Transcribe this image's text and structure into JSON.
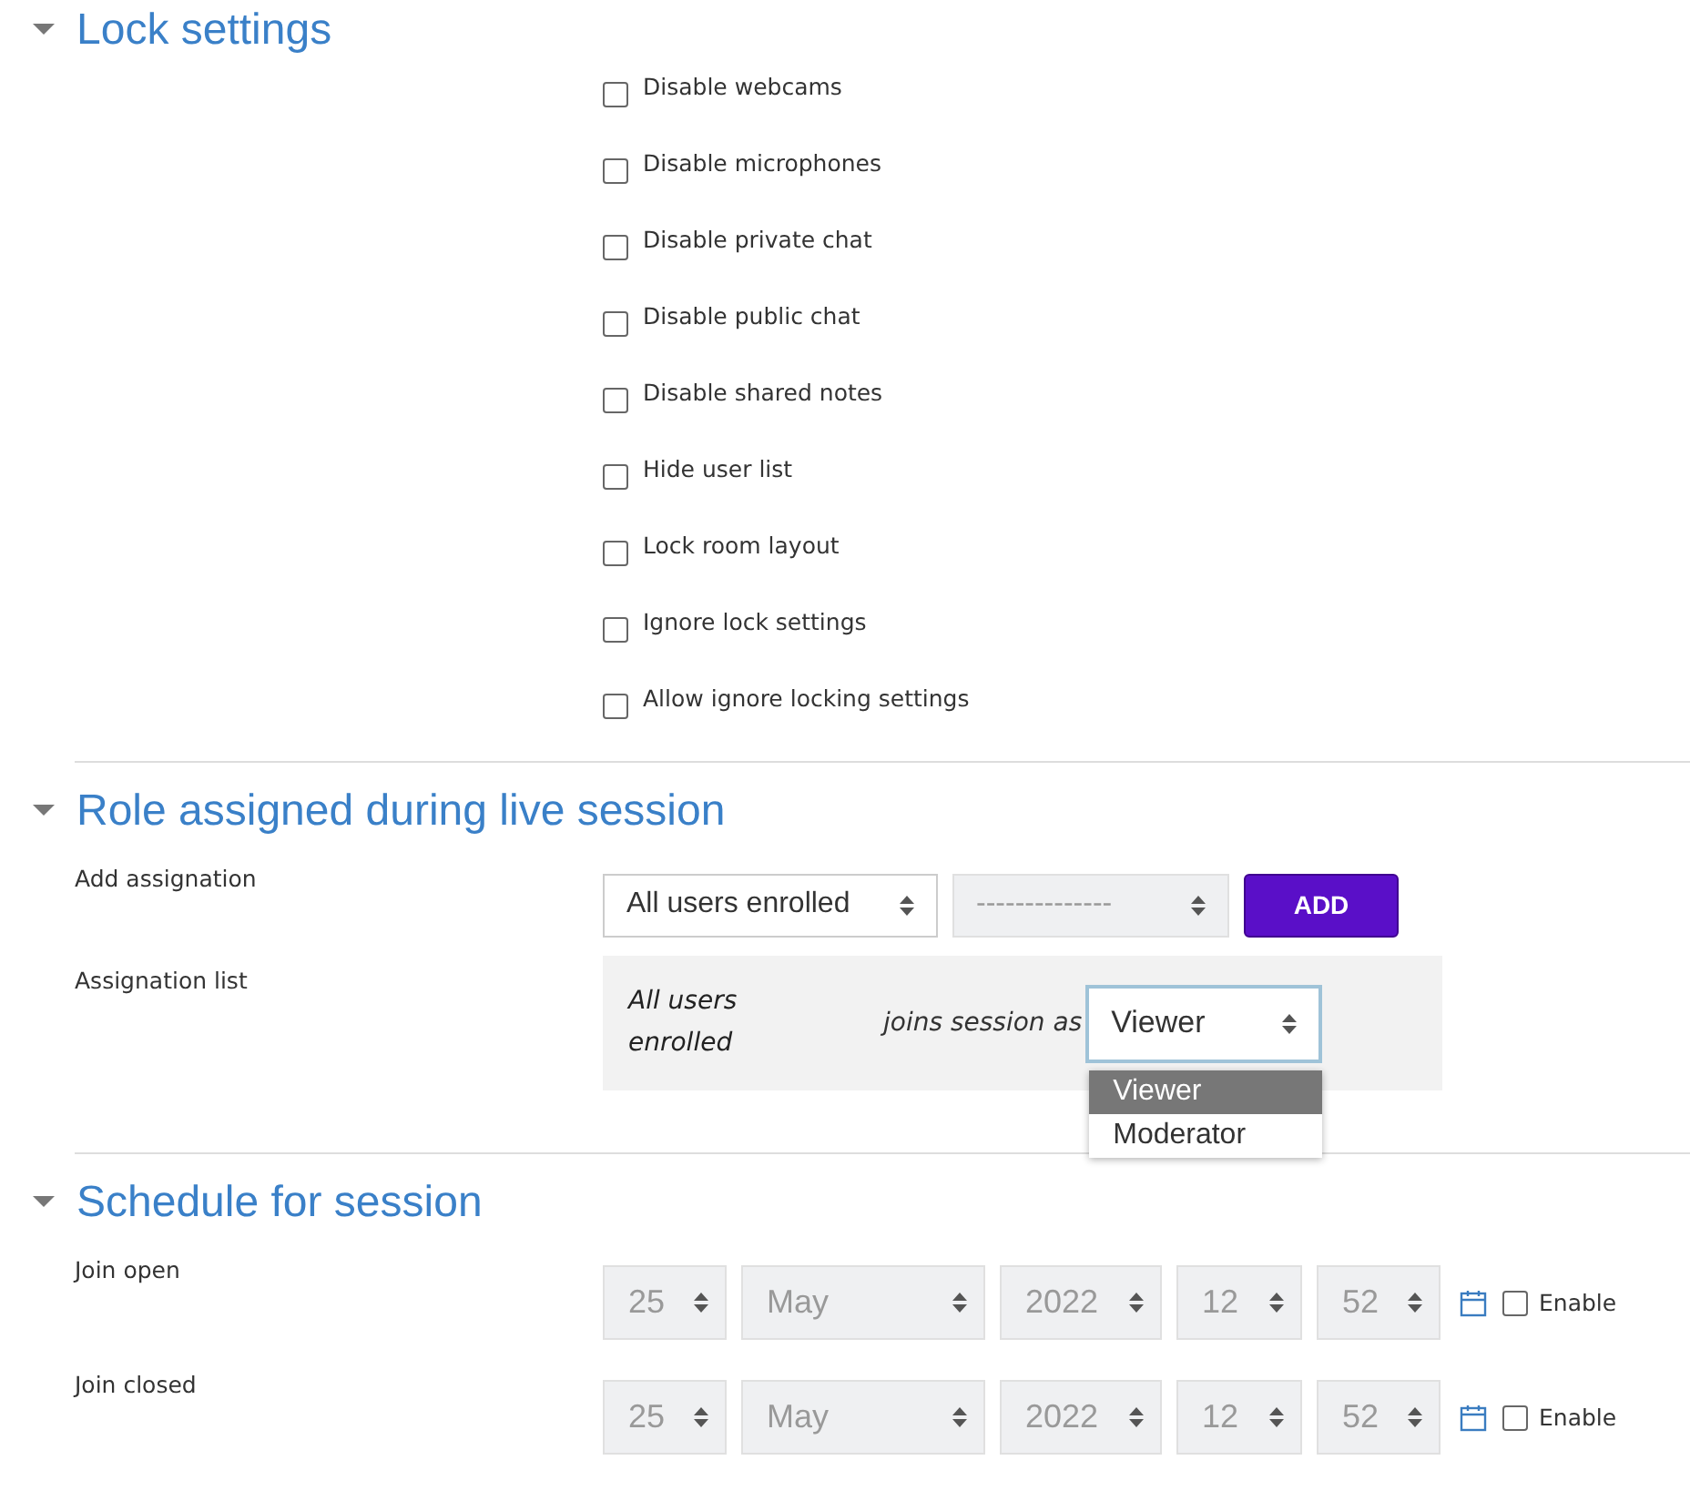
{
  "sections": [
    {
      "kind": "checkboxes",
      "title": "Lock settings",
      "expanded": true,
      "options": [
        {
          "label": "Disable webcams",
          "checked": false
        },
        {
          "label": "Disable microphones",
          "checked": false
        },
        {
          "label": "Disable private chat",
          "checked": false
        },
        {
          "label": "Disable public chat",
          "checked": false
        },
        {
          "label": "Disable shared notes",
          "checked": false
        },
        {
          "label": "Hide user list",
          "checked": false
        },
        {
          "label": "Lock room layout",
          "checked": false
        },
        {
          "label": "Ignore lock settings",
          "checked": false
        },
        {
          "label": "Allow ignore locking settings",
          "checked": false
        }
      ]
    },
    {
      "kind": "roles",
      "title": "Role assigned during live session",
      "expanded": true,
      "add_assignation": {
        "label": "Add assignation",
        "selects": [
          {
            "value": "All users enrolled",
            "disabled": false
          },
          {
            "value": "--------------",
            "disabled": true
          }
        ],
        "button": "ADD"
      },
      "assignation_list": {
        "label": "Assignation list",
        "entries": [
          {
            "who": "All users enrolled",
            "joins_text": "joins session as",
            "role": "Viewer",
            "open": true,
            "options": [
              {
                "label": "Viewer",
                "selected": true
              },
              {
                "label": "Moderator",
                "selected": false
              }
            ]
          }
        ]
      }
    },
    {
      "kind": "schedule",
      "title": "Schedule for session",
      "expanded": true,
      "rows": [
        {
          "label": "Join open",
          "fields": [
            "25",
            "May",
            "2022",
            "12",
            "52"
          ],
          "disabled": true,
          "enable_label": "Enable",
          "enabled": false
        },
        {
          "label": "Join closed",
          "fields": [
            "25",
            "May",
            "2022",
            "12",
            "52"
          ],
          "disabled": true,
          "enable_label": "Enable",
          "enabled": false
        }
      ]
    }
  ]
}
